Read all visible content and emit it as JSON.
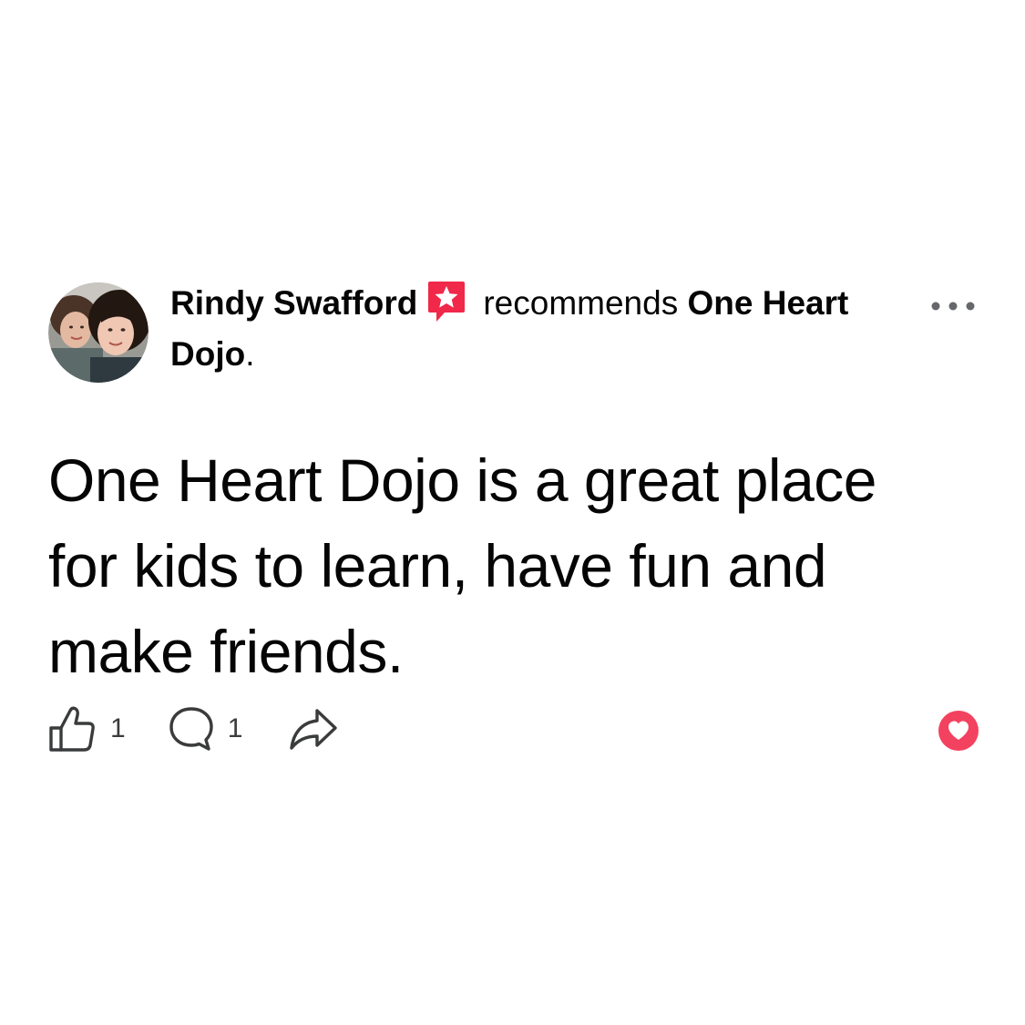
{
  "post": {
    "author": "Rindy Swafford",
    "verb": "recommends",
    "page_name": "One Heart Dojo",
    "page_suffix": ".",
    "text": "One Heart Dojo is a great place for kids to learn, have fun and make friends.",
    "likes_count": "1",
    "comments_count": "1"
  },
  "icons": {
    "avatar": "avatar-photo",
    "badge": "recommendation-star-icon",
    "more": "more-options-icon",
    "like": "thumbs-up-icon",
    "comment": "comment-icon",
    "share": "share-icon",
    "reaction": "heart-reaction-icon"
  },
  "colors": {
    "badge": "#f02849",
    "reaction": "#f3425f",
    "text": "#050505",
    "icon_gray": "#65676b"
  }
}
